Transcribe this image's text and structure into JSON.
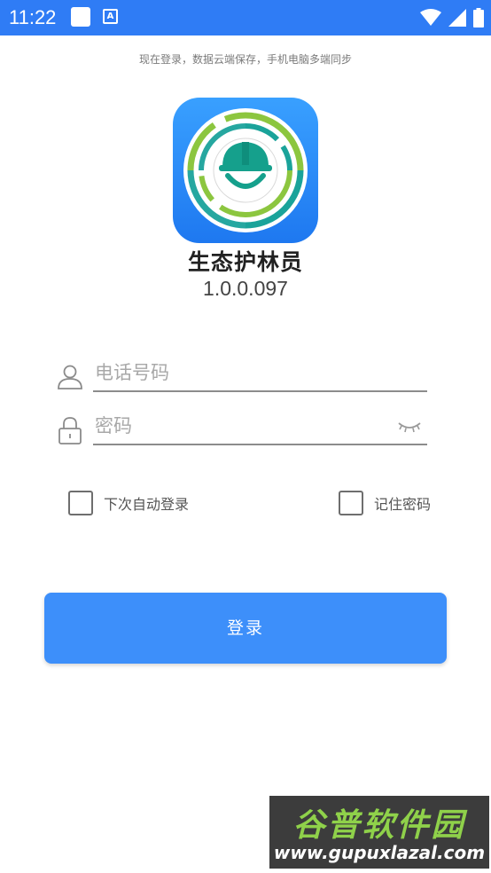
{
  "status_bar": {
    "time": "11:22",
    "notification_icons": [
      "white-square-icon",
      "a-badge-icon"
    ],
    "right_icons": [
      "wifi-icon",
      "signal-icon",
      "battery-icon"
    ],
    "notif_badge_letter": "A"
  },
  "login_hint": "现在登录，数据云端保存，手机电脑多端同步",
  "app": {
    "name": "生态护林员",
    "version": "1.0.0.097",
    "logo_icon": "forest-ranger-helmet-logo"
  },
  "form": {
    "phone": {
      "placeholder": "电话号码",
      "value": "",
      "icon": "user-icon"
    },
    "password": {
      "placeholder": "密码",
      "value": "",
      "icon": "lock-icon",
      "toggle_icon": "eye-closed-icon"
    }
  },
  "options": {
    "auto_login": {
      "label": "下次自动登录",
      "checked": false
    },
    "remember_password": {
      "label": "记住密码",
      "checked": false
    }
  },
  "login_button_label": "登录",
  "watermark": {
    "title": "谷普软件园",
    "url": "www.gupuxlazal.com"
  },
  "colors": {
    "status_bar": "#2f7cf5",
    "button": "#3d8ffa",
    "logo_bg": "#1e78f0"
  }
}
